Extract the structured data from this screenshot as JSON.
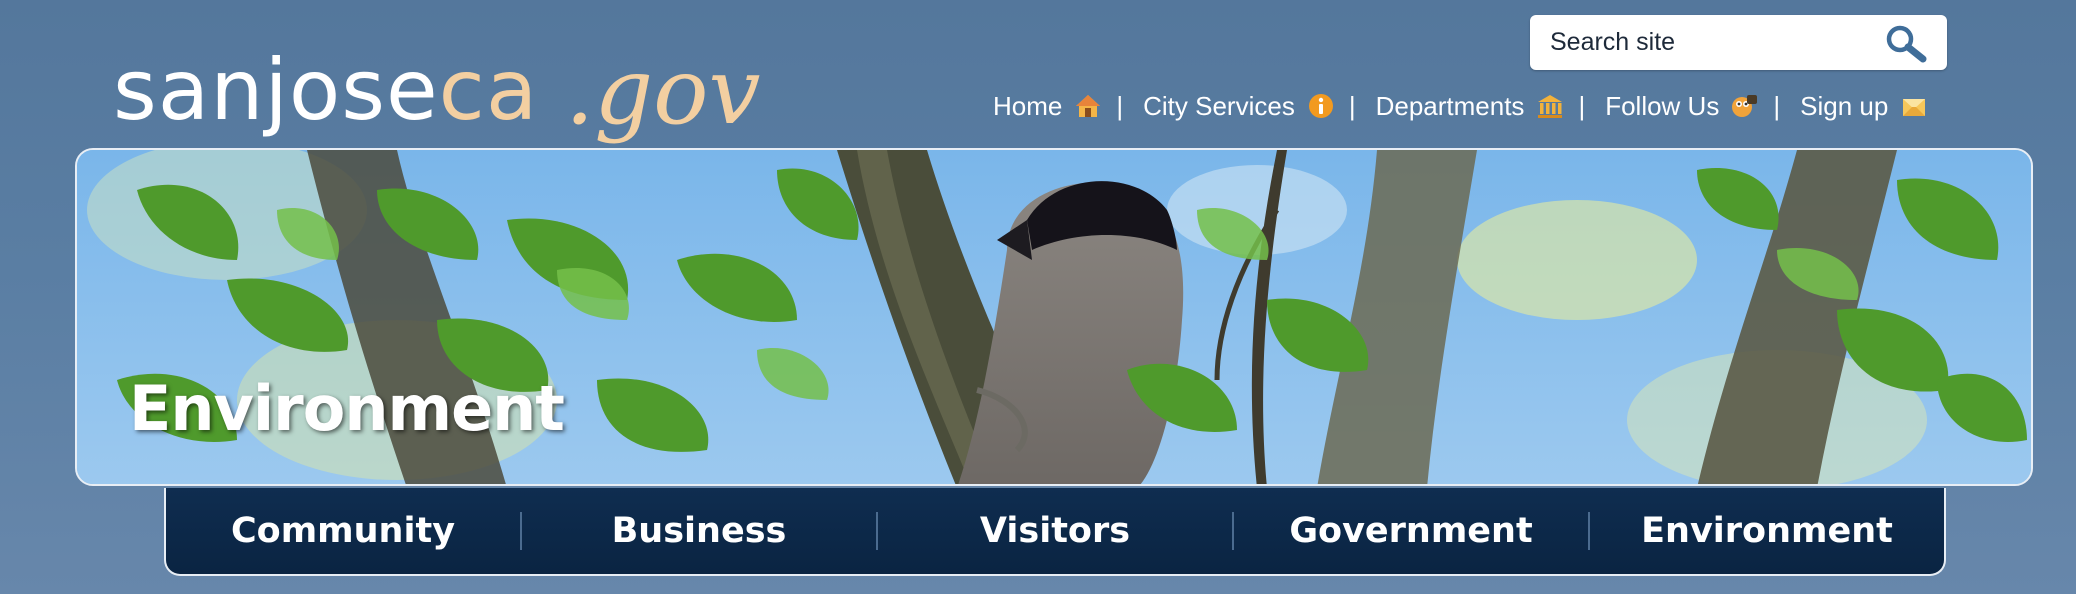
{
  "logo": {
    "main_white": "sanjose",
    "main_ca": "ca",
    "gov": ".gov",
    "brand_color": "#f3cfa1"
  },
  "search": {
    "placeholder": "Search site",
    "icon": "search-icon"
  },
  "utility_nav": [
    {
      "label": "Home",
      "icon": "home-icon"
    },
    {
      "label": "City Services",
      "icon": "info-icon"
    },
    {
      "label": "Departments",
      "icon": "building-icon"
    },
    {
      "label": "Follow Us",
      "icon": "follow-icon"
    },
    {
      "label": "Sign up",
      "icon": "envelope-icon"
    }
  ],
  "utility_separator": "|",
  "banner": {
    "title": "Environment"
  },
  "main_nav": [
    {
      "label": "Community"
    },
    {
      "label": "Business"
    },
    {
      "label": "Visitors"
    },
    {
      "label": "Government"
    },
    {
      "label": "Environment"
    }
  ],
  "colors": {
    "page_background": "#587ca1",
    "nav_background": "#0d2a4b",
    "divider": "#4b6b8f"
  }
}
